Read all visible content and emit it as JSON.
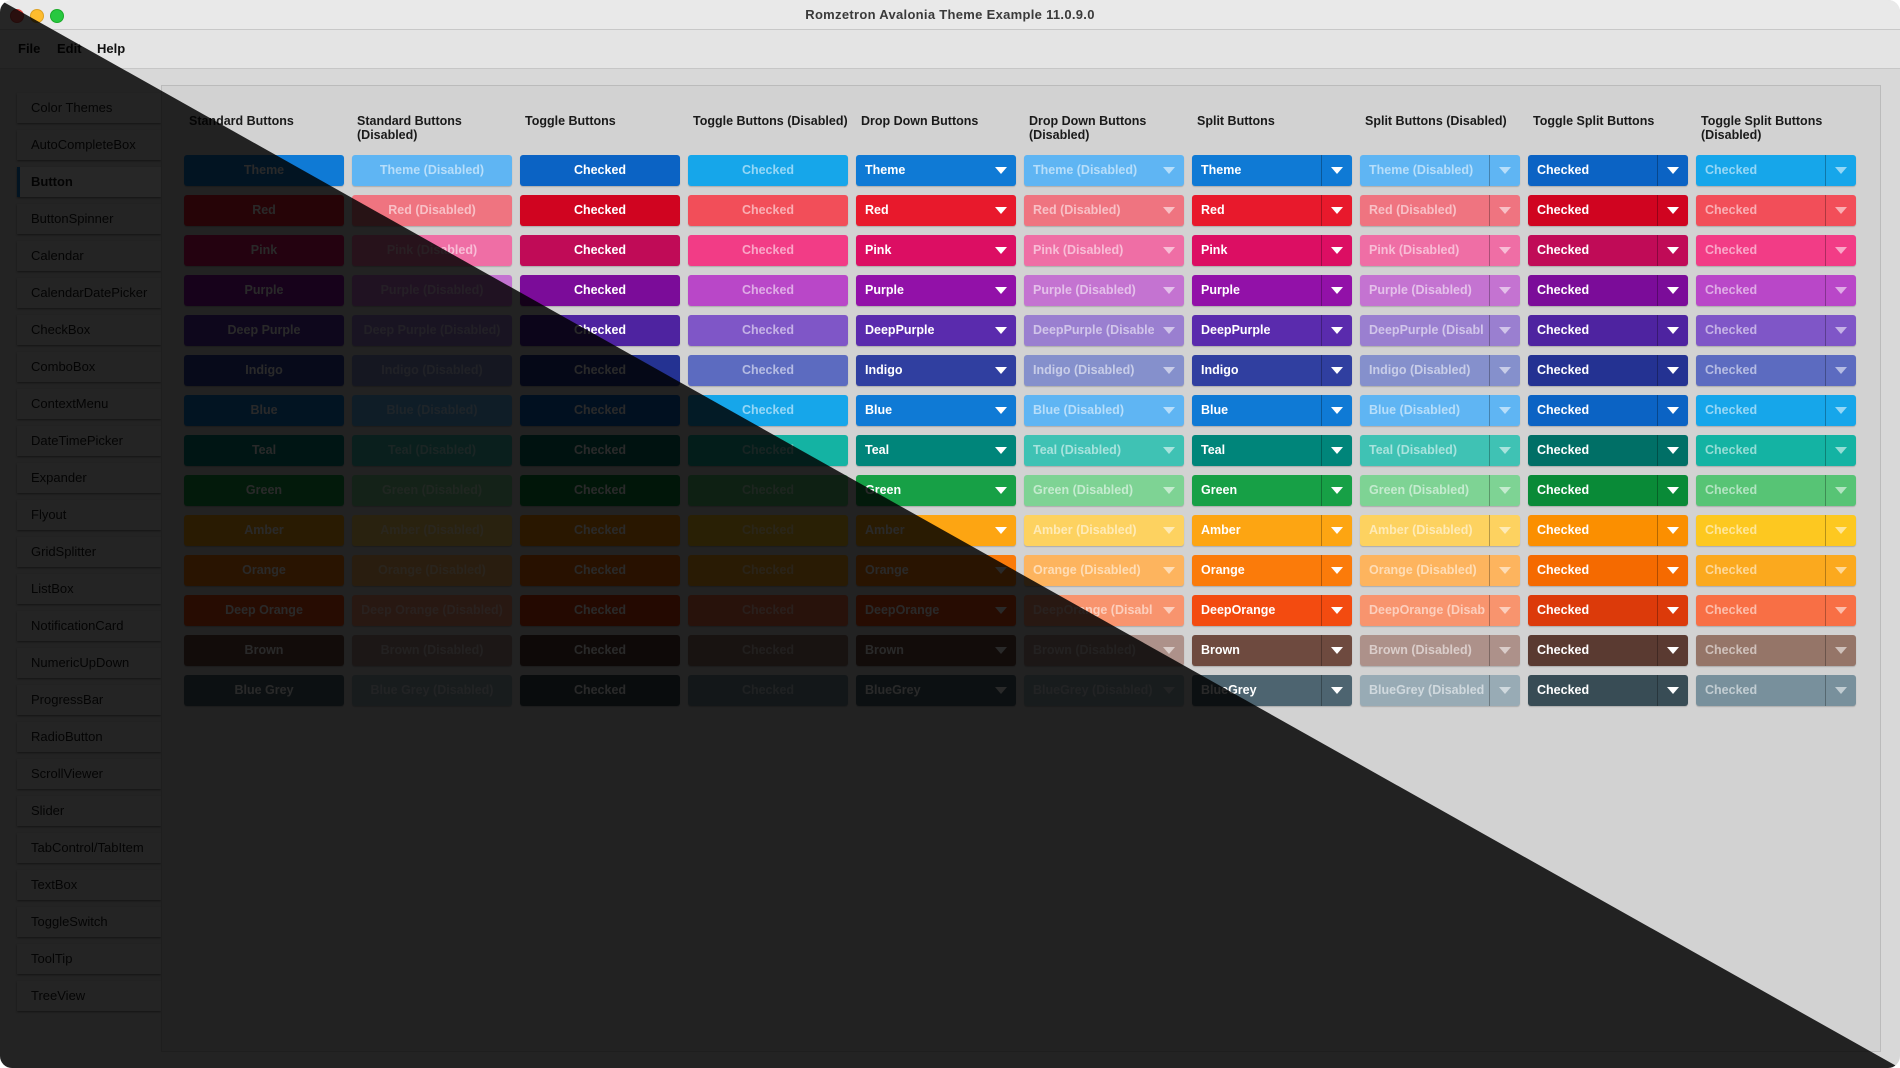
{
  "window": {
    "title": "Romzetron Avalonia Theme Example 11.0.9.0"
  },
  "menu": {
    "file": "File",
    "edit": "Edit",
    "help": "Help"
  },
  "sidebar": {
    "selected_index": 2,
    "items": [
      "Color Themes",
      "AutoCompleteBox",
      "Button",
      "ButtonSpinner",
      "Calendar",
      "CalendarDatePicker",
      "CheckBox",
      "ComboBox",
      "ContextMenu",
      "DateTimePicker",
      "Expander",
      "Flyout",
      "GridSplitter",
      "ListBox",
      "NotificationCard",
      "NumericUpDown",
      "ProgressBar",
      "RadioButton",
      "ScrollViewer",
      "Slider",
      "TabControl/TabItem",
      "TextBox",
      "ToggleSwitch",
      "ToolTip",
      "TreeView"
    ]
  },
  "columns": [
    {
      "header": [
        "Standard Buttons"
      ],
      "kind": "standard",
      "disabled": false
    },
    {
      "header": [
        "Standard Buttons",
        "(Disabled)"
      ],
      "kind": "standard",
      "disabled": true
    },
    {
      "header": [
        "Toggle Buttons"
      ],
      "kind": "toggle",
      "disabled": false
    },
    {
      "header": [
        "Toggle Buttons (Disabled)"
      ],
      "kind": "toggle",
      "disabled": true
    },
    {
      "header": [
        "Drop Down Buttons"
      ],
      "kind": "dropdown",
      "disabled": false
    },
    {
      "header": [
        "Drop Down Buttons",
        "(Disabled)"
      ],
      "kind": "dropdown",
      "disabled": true
    },
    {
      "header": [
        "Split Buttons"
      ],
      "kind": "split",
      "disabled": false
    },
    {
      "header": [
        "Split Buttons (Disabled)"
      ],
      "kind": "split",
      "disabled": true
    },
    {
      "header": [
        "Toggle Split Buttons"
      ],
      "kind": "togglesplit",
      "disabled": false
    },
    {
      "header": [
        "Toggle Split Buttons",
        "(Disabled)"
      ],
      "kind": "togglesplit",
      "disabled": true
    }
  ],
  "rows": [
    {
      "std": "Theme",
      "std_dis": "Theme (Disabled)",
      "dd": "Theme",
      "dd_dis": "Theme (Disabled)",
      "split": "Theme",
      "split_dis": "Theme (Disabled)",
      "colors": {
        "main": "#0f7ad5",
        "dis": "#5fb5f3",
        "toggle": "#0b63c4",
        "toggle_dis": "#16a6ea"
      }
    },
    {
      "std": "Red",
      "std_dis": "Red (Disabled)",
      "dd": "Red",
      "dd_dis": "Red (Disabled)",
      "split": "Red",
      "split_dis": "Red (Disabled)",
      "colors": {
        "main": "#e8192c",
        "dis": "#ef7480",
        "toggle": "#d00420",
        "toggle_dis": "#f24e59"
      }
    },
    {
      "std": "Pink",
      "std_dis": "Pink (Disabled)",
      "dd": "Pink",
      "dd_dis": "Pink (Disabled)",
      "split": "Pink",
      "split_dis": "Pink (Disabled)",
      "colors": {
        "main": "#dc0e63",
        "dis": "#ef6ea5",
        "toggle": "#c00b57",
        "toggle_dis": "#f23c86"
      }
    },
    {
      "std": "Purple",
      "std_dis": "Purple (Disabled)",
      "dd": "Purple",
      "dd_dis": "Purple (Disabled)",
      "split": "Purple",
      "split_dis": "Purple (Disabled)",
      "colors": {
        "main": "#9211a8",
        "dis": "#c473d1",
        "toggle": "#7b0c99",
        "toggle_dis": "#b947c8"
      }
    },
    {
      "std": "Deep Purple",
      "std_dis": "Deep Purple (Disabled)",
      "dd": "DeepPurple",
      "dd_dis": "DeepPurple (Disable",
      "split": "DeepPurple",
      "split_dis": "DeepPurple (Disabl",
      "colors": {
        "main": "#5a2bad",
        "dis": "#9a7fd0",
        "toggle": "#4e23a0",
        "toggle_dis": "#7f56c7"
      }
    },
    {
      "std": "Indigo",
      "std_dis": "Indigo (Disabled)",
      "dd": "Indigo",
      "dd_dis": "Indigo (Disabled)",
      "split": "Indigo",
      "split_dis": "Indigo (Disabled)",
      "colors": {
        "main": "#303fa0",
        "dis": "#8590cc",
        "toggle": "#243292",
        "toggle_dis": "#5c6bc0"
      }
    },
    {
      "std": "Blue",
      "std_dis": "Blue (Disabled)",
      "dd": "Blue",
      "dd_dis": "Blue (Disabled)",
      "split": "Blue",
      "split_dis": "Blue (Disabled)",
      "colors": {
        "main": "#0f7ad5",
        "dis": "#5fb5f3",
        "toggle": "#0b63c4",
        "toggle_dis": "#16a6ea"
      }
    },
    {
      "std": "Teal",
      "std_dis": "Teal (Disabled)",
      "dd": "Teal",
      "dd_dis": "Teal (Disabled)",
      "split": "Teal",
      "split_dis": "Teal (Disabled)",
      "colors": {
        "main": "#00857a",
        "dis": "#3fc2b4",
        "toggle": "#006f66",
        "toggle_dis": "#14b3a3"
      }
    },
    {
      "std": "Green",
      "std_dis": "Green (Disabled)",
      "dd": "Green",
      "dd_dis": "Green (Disabled)",
      "split": "Green",
      "split_dis": "Green (Disabled)",
      "colors": {
        "main": "#17a046",
        "dis": "#7ed394",
        "toggle": "#098a37",
        "toggle_dis": "#57c475"
      }
    },
    {
      "std": "Amber",
      "std_dis": "Amber (Disabled)",
      "dd": "Amber",
      "dd_dis": "Amber (Disabled)",
      "split": "Amber",
      "split_dis": "Amber (Disabled)",
      "colors": {
        "main": "#fda512",
        "dis": "#fdd260",
        "toggle": "#fb8f00",
        "toggle_dis": "#fdc820"
      }
    },
    {
      "std": "Orange",
      "std_dis": "Orange (Disabled)",
      "dd": "Orange",
      "dd_dis": "Orange (Disabled)",
      "split": "Orange",
      "split_dis": "Orange (Disabled)",
      "colors": {
        "main": "#fb7b0a",
        "dis": "#fdb45e",
        "toggle": "#f56a00",
        "toggle_dis": "#fba91e"
      }
    },
    {
      "std": "Deep Orange",
      "std_dis": "Deep Orange (Disabled)",
      "dd": "DeepOrange",
      "dd_dis": "DeepOrange (Disabl",
      "split": "DeepOrange",
      "split_dis": "DeepOrange (Disab",
      "colors": {
        "main": "#f34b10",
        "dis": "#f8946e",
        "toggle": "#dc3a0a",
        "toggle_dis": "#f86f45"
      }
    },
    {
      "std": "Brown",
      "std_dis": "Brown (Disabled)",
      "dd": "Brown",
      "dd_dis": "Brown (Disabled)",
      "split": "Brown",
      "split_dis": "Brown (Disabled)",
      "colors": {
        "main": "#6e4a3f",
        "dis": "#ad918a",
        "toggle": "#5a3a31",
        "toggle_dis": "#957568"
      }
    },
    {
      "std": "Blue Grey",
      "std_dis": "Blue Grey (Disabled)",
      "dd": "BlueGrey",
      "dd_dis": "BlueGrey (Disabled)",
      "split": "BlueGrey",
      "split_dis": "BlueGrey (Disabled",
      "colors": {
        "main": "#4d6470",
        "dis": "#98abb5",
        "toggle": "#384c55",
        "toggle_dis": "#78909c"
      }
    }
  ],
  "checked_label": "Checked"
}
